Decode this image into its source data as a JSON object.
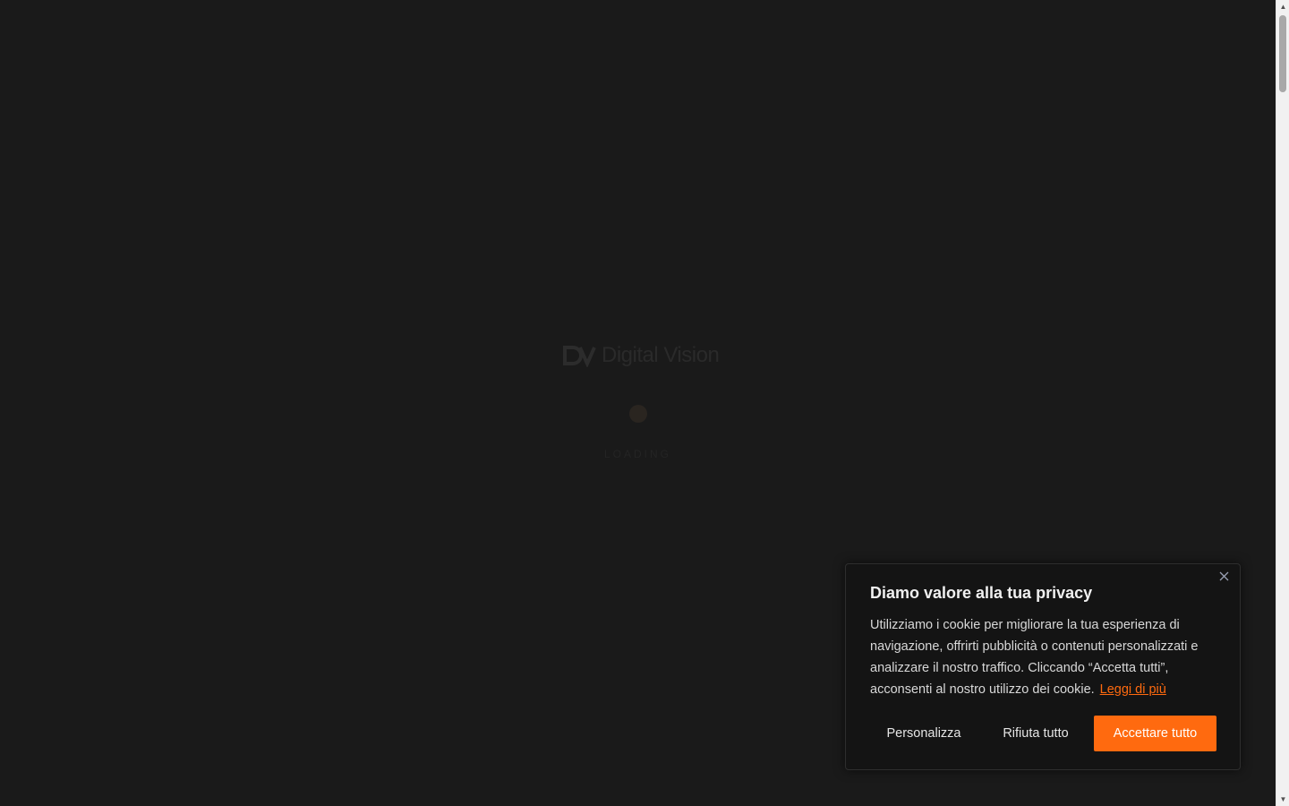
{
  "loader": {
    "logo_text": "Digital Vision",
    "loading_text": "LOADING"
  },
  "cookie": {
    "title": "Diamo valore alla tua privacy",
    "body": "Utilizziamo i cookie per migliorare la tua esperienza di navigazione, offrirti pubblicità o contenuti personalizzati e analizzare il nostro traffico. Cliccando “Accetta tutti”, acconsenti al nostro utilizzo dei cookie.",
    "read_more": "Leggi di più",
    "customize_label": "Personalizza",
    "reject_label": "Rifiuta tutto",
    "accept_label": "Accettare tutto",
    "close_icon": "close-icon"
  },
  "colors": {
    "accent": "#ff6a0f",
    "background": "#1a1a1a",
    "dialog_background": "#141414"
  },
  "scrollbar": {
    "up_icon": "arrow-up-icon",
    "down_icon": "arrow-down-icon"
  }
}
